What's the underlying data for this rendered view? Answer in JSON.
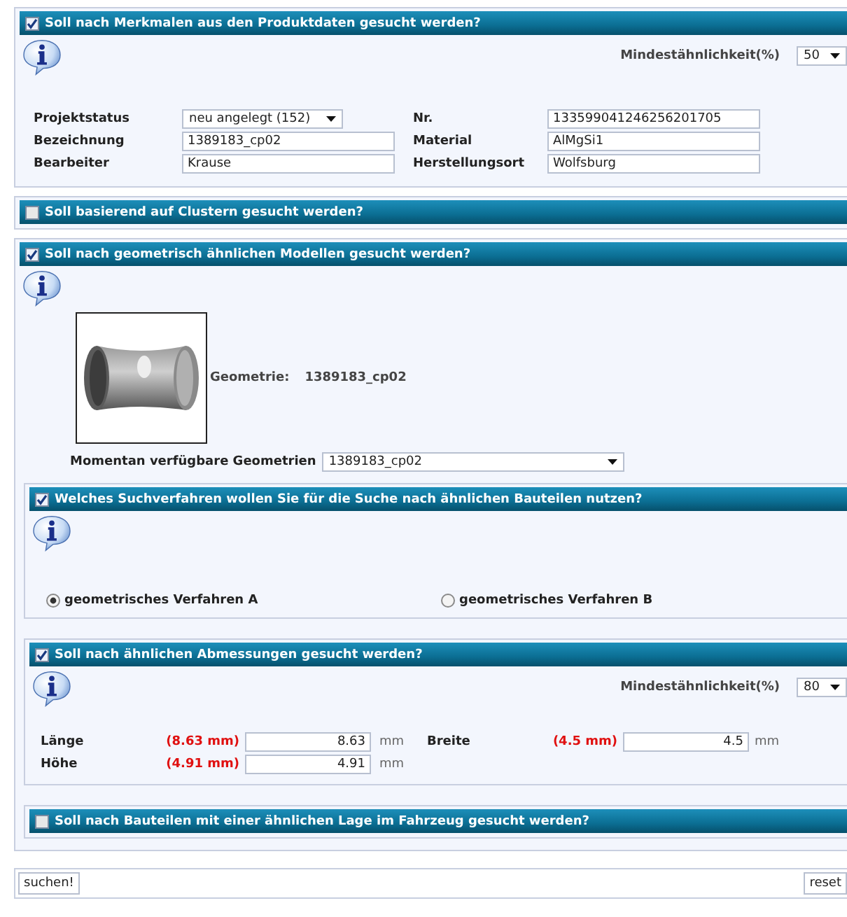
{
  "sections": [
    {
      "kind": "attributes",
      "title": "Soll nach Merkmalen aus den Produktdaten gesucht werden?",
      "checked": true,
      "similarity": {
        "label": "Mindestähnlichkeit(%)",
        "value": "50"
      },
      "fields": [
        {
          "label": "Projektstatus",
          "value": "neu angelegt (152)",
          "kind": "select"
        },
        {
          "label": "Nr.",
          "value": "133599041246256201705",
          "kind": "text"
        },
        {
          "label": "Bezeichnung",
          "value": "1389183_cp02",
          "kind": "text"
        },
        {
          "label": "Material",
          "value": "AlMgSi1",
          "kind": "text"
        },
        {
          "label": "Bearbeiter",
          "value": "Krause",
          "kind": "text"
        },
        {
          "label": "Herstellungsort",
          "value": "Wolfsburg",
          "kind": "text"
        }
      ]
    },
    {
      "kind": "collapsed",
      "title": "Soll basierend auf Clustern gesucht werden?",
      "checked": false
    },
    {
      "kind": "geometry",
      "title": "Soll nach geometrisch ähnlichen Modellen gesucht werden?",
      "checked": true,
      "geometry_label": "Geometrie:",
      "geometry_value": "1389183_cp02",
      "available": {
        "label": "Momentan verfügbare Geometrien",
        "value": "1389183_cp02"
      },
      "subsections": [
        {
          "kind": "method",
          "title": "Welches Suchverfahren wollen Sie für die Suche nach ähnlichen Bauteilen nutzen?",
          "checked": true,
          "options": [
            {
              "label": "geometrisches Verfahren A",
              "selected": true
            },
            {
              "label": "geometrisches Verfahren B",
              "selected": false
            }
          ]
        },
        {
          "kind": "dimensions",
          "title": "Soll nach ähnlichen Abmessungen gesucht werden?",
          "checked": true,
          "similarity": {
            "label": "Mindestähnlichkeit(%)",
            "value": "80"
          },
          "dims": [
            {
              "label": "Länge",
              "reference": "(8.63 mm)",
              "value": "8.63",
              "unit": "mm"
            },
            {
              "label": "Breite",
              "reference": "(4.5 mm)",
              "value": "4.5",
              "unit": "mm"
            },
            {
              "label": "Höhe",
              "reference": "(4.91 mm)",
              "value": "4.91",
              "unit": "mm"
            }
          ]
        },
        {
          "kind": "collapsed",
          "title": "Soll nach Bauteilen mit einer ähnlichen Lage im Fahrzeug gesucht werden?",
          "checked": false
        }
      ]
    }
  ],
  "buttons": [
    {
      "label": "suchen!"
    },
    {
      "label": "reset"
    }
  ]
}
